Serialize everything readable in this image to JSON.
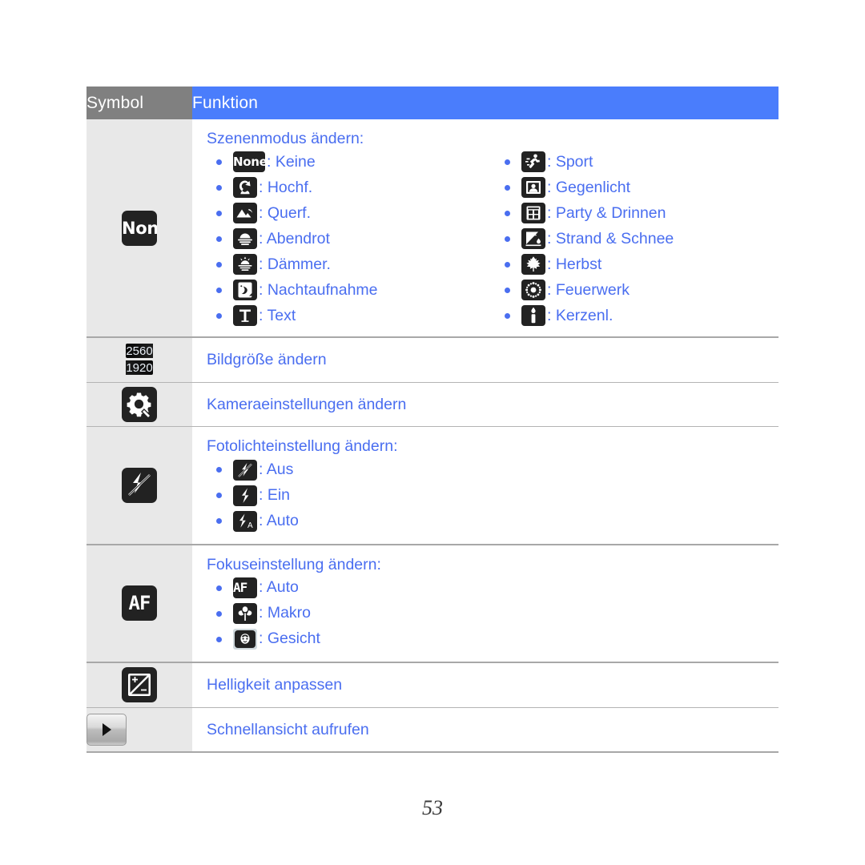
{
  "page": {
    "number": "53"
  },
  "table": {
    "header": {
      "symbol": "Symbol",
      "funktion": "Funktion"
    },
    "rows": [
      {
        "id": "scene-mode",
        "symbol_icon": "none-scene-icon",
        "title": "Szenenmodus ändern:",
        "options_left": [
          {
            "icon": "none-icon",
            "label": ": Keine"
          },
          {
            "icon": "portrait-icon",
            "label": ": Hochf."
          },
          {
            "icon": "landscape-icon",
            "label": ": Querf."
          },
          {
            "icon": "sunset-icon",
            "label": ": Abendrot"
          },
          {
            "icon": "dawn-icon",
            "label": ": Dämmer."
          },
          {
            "icon": "night-icon",
            "label": ": Nachtaufnahme"
          },
          {
            "icon": "text-icon",
            "label": ": Text"
          }
        ],
        "options_right": [
          {
            "icon": "sports-icon",
            "label": ": Sport"
          },
          {
            "icon": "backlight-icon",
            "label": ": Gegenlicht"
          },
          {
            "icon": "party-indoor-icon",
            "label": ": Party & Drinnen"
          },
          {
            "icon": "beach-snow-icon",
            "label": ": Strand & Schnee"
          },
          {
            "icon": "fall-color-icon",
            "label": ": Herbst"
          },
          {
            "icon": "firework-icon",
            "label": ": Feuerwerk"
          },
          {
            "icon": "candlelight-icon",
            "label": ": Kerzenl."
          }
        ]
      },
      {
        "id": "image-size",
        "symbol_icon": "resolution-icon",
        "resolution_width": "2560",
        "resolution_height": "1920",
        "title": "Bildgröße ändern"
      },
      {
        "id": "camera-settings",
        "symbol_icon": "gear-wrench-icon",
        "title": "Kameraeinstellungen ändern"
      },
      {
        "id": "flash-setting",
        "symbol_icon": "flash-off-icon",
        "title": "Fotolichteinstellung ändern:",
        "options": [
          {
            "icon": "flash-off-icon",
            "label": ": Aus"
          },
          {
            "icon": "flash-on-icon",
            "label": ": Ein"
          },
          {
            "icon": "flash-auto-icon",
            "label": ": Auto"
          }
        ]
      },
      {
        "id": "focus-setting",
        "symbol_icon": "autofocus-icon",
        "title": "Fokuseinstellung ändern:",
        "options": [
          {
            "icon": "autofocus-icon",
            "label": ": Auto"
          },
          {
            "icon": "macro-icon",
            "label": ": Makro"
          },
          {
            "icon": "face-detect-icon",
            "label": ": Gesicht"
          }
        ]
      },
      {
        "id": "brightness",
        "symbol_icon": "exposure-icon",
        "title": "Helligkeit anpassen"
      },
      {
        "id": "quick-view",
        "symbol_icon": "play-icon",
        "title": "Schnellansicht aufrufen"
      }
    ]
  },
  "colors": {
    "header_symbol_bg": "#808080",
    "header_funktion_bg": "#4a7dfc",
    "symbol_col_bg": "#e8e8e8",
    "text_blue": "#4a6ef0",
    "icon_bg": "#222222"
  }
}
